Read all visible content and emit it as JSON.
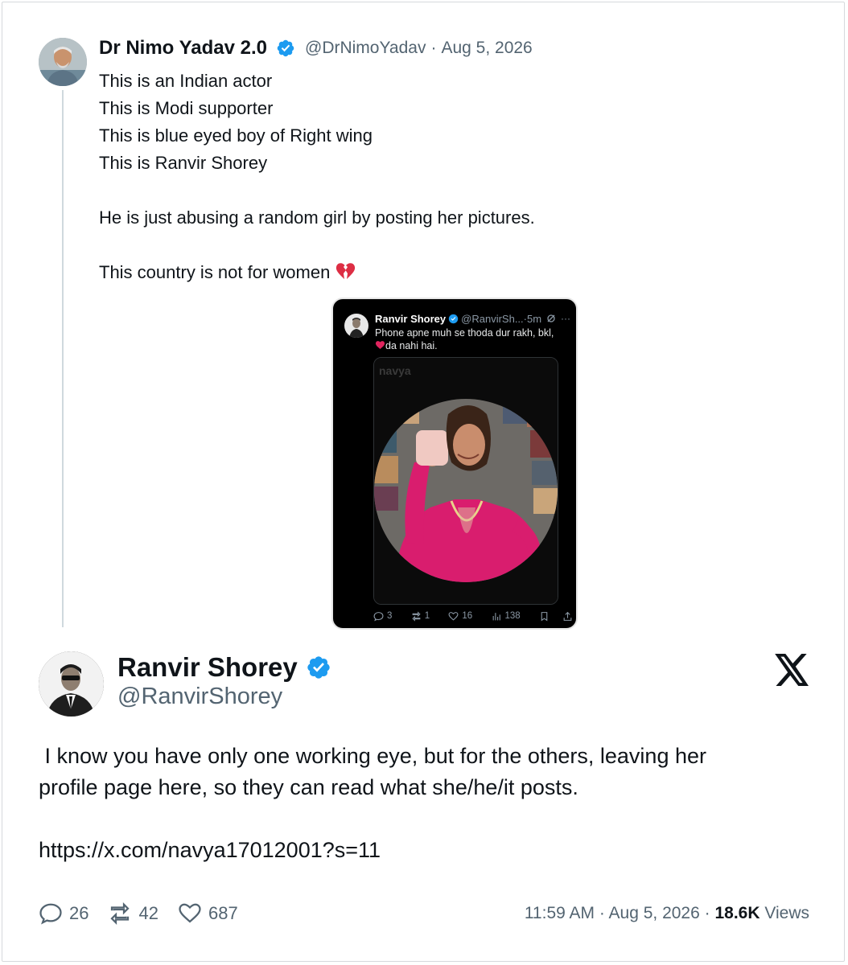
{
  "quoted_tweet": {
    "author_name": "Dr Nimo Yadav 2.0",
    "handle": "@DrNimoYadav",
    "separator": "·",
    "date": "Aug 5, 2026",
    "lines": [
      "This is an Indian actor",
      "This is Modi supporter",
      "This is blue eyed boy of Right wing",
      "This is Ranvir Shorey",
      "",
      "He is just abusing a random girl by posting her pictures.",
      "",
      "This country is not for women"
    ],
    "emoji": "broken-heart-icon",
    "embedded_screenshot": {
      "author_name": "Ranvir Shorey",
      "meta": "@RanvirSh...·5m",
      "text_line1": "Phone apne muh se thoda dur rakh, bkl,",
      "text_line2": "da nahi hai.",
      "card_name": "navya",
      "replies": "3",
      "reposts": "1",
      "likes": "16",
      "views": "138"
    }
  },
  "main_tweet": {
    "author_name": "Ranvir Shorey",
    "handle": "@RanvirShorey",
    "body_line1": " I know you have only one working eye, but for the others, leaving her",
    "body_line2": "profile page here, so they can read what she/he/it posts.",
    "link": "https://x.com/navya17012001?s=11",
    "replies": "26",
    "reposts": "42",
    "likes": "687",
    "time": "11:59 AM",
    "separator": "·",
    "date": "Aug 5, 2026",
    "views_count": "18.6K",
    "views_label": "Views"
  },
  "colors": {
    "text": "#0f1419",
    "secondary": "#536471",
    "verified": "#1d9bf0",
    "thread_line": "#cfd9de"
  }
}
